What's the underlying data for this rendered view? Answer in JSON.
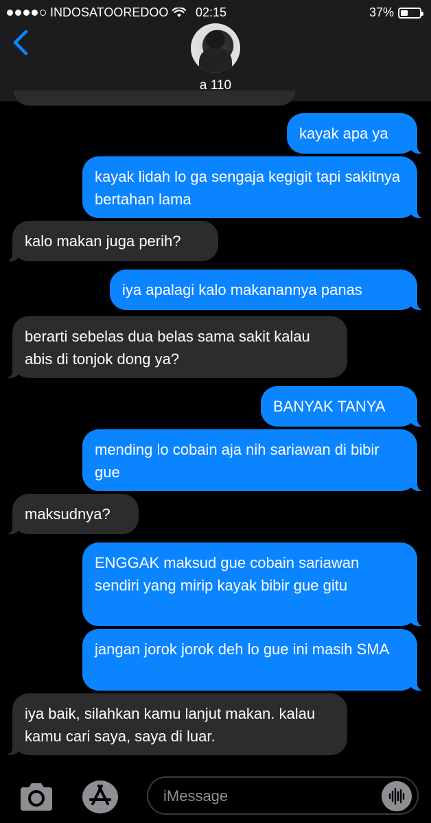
{
  "status_bar": {
    "carrier": "INDOSATOOREDOO",
    "time": "02:15",
    "battery": "37%",
    "battery_level": 0.37
  },
  "header": {
    "contact_name": "a 110"
  },
  "messages": [
    {
      "side": "out",
      "text": "kayak apa ya"
    },
    {
      "side": "out",
      "text": "kayak lidah lo ga sengaja kegigit tapi sakitnya bertahan lama"
    },
    {
      "side": "in",
      "text": "kalo makan juga perih?"
    },
    {
      "side": "out",
      "text": "iya apalagi kalo makanannya panas"
    },
    {
      "side": "in",
      "text": "berarti sebelas dua belas sama sakit kalau abis di tonjok dong ya?"
    },
    {
      "side": "out",
      "text": "BANYAK TANYA"
    },
    {
      "side": "out",
      "text": "mending lo cobain aja nih sariawan di bibir gue"
    },
    {
      "side": "in",
      "text": "maksudnya?"
    },
    {
      "side": "out",
      "text": "ENGGAK maksud gue cobain sariawan sendiri yang mirip kayak bibir gue gitu"
    },
    {
      "side": "out",
      "text": "jangan jorok jorok deh lo gue ini masih SMA"
    },
    {
      "side": "in",
      "text": "iya baik, silahkan kamu lanjut makan. kalau kamu cari saya, saya di luar."
    }
  ],
  "composer": {
    "placeholder": "iMessage"
  },
  "icons": [
    "back-chevron-icon",
    "camera-icon",
    "app-store-icon",
    "audio-waveform-icon"
  ],
  "colors": {
    "outgoing_bubble": "#0b84ff",
    "incoming_bubble": "#2c2c2e",
    "background": "#000000",
    "header": "#1c1c1e"
  }
}
